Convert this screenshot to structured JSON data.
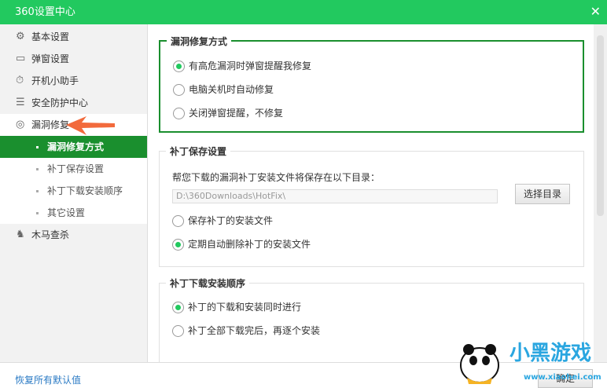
{
  "window": {
    "title": "360设置中心",
    "close": "✕"
  },
  "sidebar": {
    "items": [
      {
        "label": "基本设置",
        "icon": "gear-icon",
        "glyph": "⚙"
      },
      {
        "label": "弹窗设置",
        "icon": "window-icon",
        "glyph": "▭"
      },
      {
        "label": "开机小助手",
        "icon": "timer-icon",
        "glyph": "⏱"
      },
      {
        "label": "安全防护中心",
        "icon": "shield-wall-icon",
        "glyph": "☰"
      },
      {
        "label": "漏洞修复",
        "icon": "repair-icon",
        "glyph": "◎"
      },
      {
        "label": "木马查杀",
        "icon": "horse-icon",
        "glyph": "♞"
      }
    ],
    "subitems": [
      "漏洞修复方式",
      "补丁保存设置",
      "补丁下载安装顺序",
      "其它设置"
    ]
  },
  "main": {
    "g1": {
      "title": "漏洞修复方式",
      "options": [
        "有高危漏洞时弹窗提醒我修复",
        "电脑关机时自动修复",
        "关闭弹窗提醒，不修复"
      ]
    },
    "g2": {
      "title": "补丁保存设置",
      "desc": "帮您下载的漏洞补丁安装文件将保存在以下目录：",
      "path": "D:\\360Downloads\\HotFix\\",
      "choose": "选择目录",
      "options": [
        "保存补丁的安装文件",
        "定期自动删除补丁的安装文件"
      ]
    },
    "g3": {
      "title": "补丁下载安装顺序",
      "options": [
        "补丁的下载和安装同时进行",
        "补丁全部下载完后，再逐个安装"
      ]
    }
  },
  "footer": {
    "restore": "恢复所有默认值",
    "ok": "确定"
  },
  "watermark": {
    "text": "小黑游戏",
    "url": "www.xiaohei.com"
  }
}
